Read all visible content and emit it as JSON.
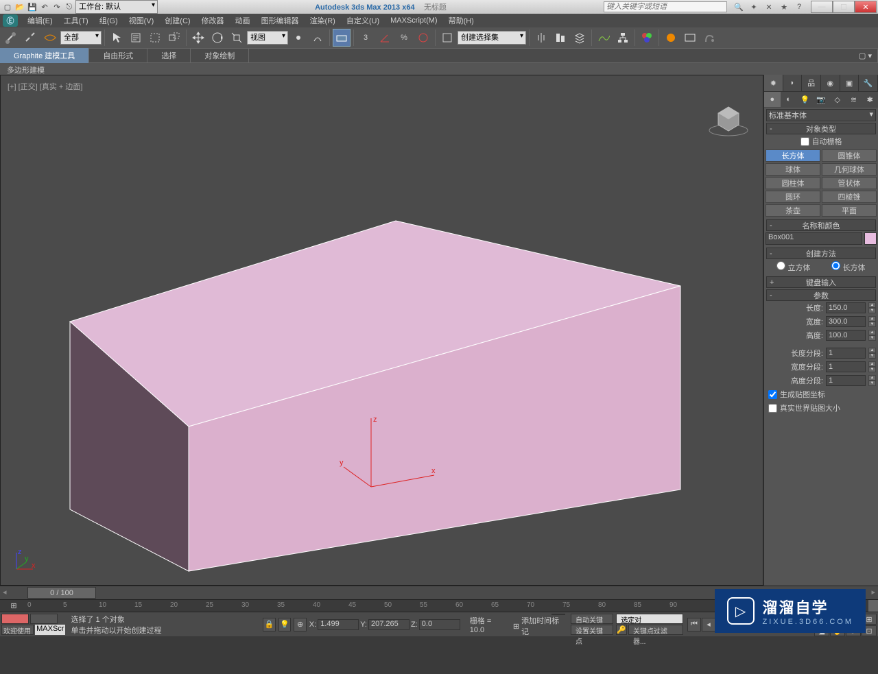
{
  "titlebar": {
    "workspace_label": "工作台: 默认",
    "app_title": "Autodesk 3ds Max  2013 x64",
    "doc_title": "无标题",
    "search_placeholder": "键入关键字或短语"
  },
  "menus": [
    "编辑(E)",
    "工具(T)",
    "组(G)",
    "视图(V)",
    "创建(C)",
    "修改器",
    "动画",
    "图形编辑器",
    "渲染(R)",
    "自定义(U)",
    "MAXScript(M)",
    "帮助(H)"
  ],
  "toolbar": {
    "filter_all": "全部",
    "view_mode": "视图",
    "selection_set": "创建选择集"
  },
  "ribbon": {
    "tabs": [
      "Graphite 建模工具",
      "自由形式",
      "选择",
      "对象绘制"
    ],
    "subpanel": "多边形建模"
  },
  "viewport": {
    "label": "[+] [正交] [真实 + 边面]",
    "axes": {
      "x": "x",
      "y": "y",
      "z": "z"
    }
  },
  "command_panel": {
    "category": "标准基本体",
    "object_type_header": "对象类型",
    "autogrid": "自动栅格",
    "primitives": [
      [
        "长方体",
        "圆锥体"
      ],
      [
        "球体",
        "几何球体"
      ],
      [
        "圆柱体",
        "管状体"
      ],
      [
        "圆环",
        "四棱锥"
      ],
      [
        "茶壶",
        "平面"
      ]
    ],
    "name_color_header": "名称和颜色",
    "object_name": "Box001",
    "creation_method_header": "创建方法",
    "creation_cube": "立方体",
    "creation_box": "长方体",
    "keyboard_entry_header": "键盘输入",
    "params_header": "参数",
    "length_label": "长度:",
    "length_value": "150.0",
    "width_label": "宽度:",
    "width_value": "300.0",
    "height_label": "高度:",
    "height_value": "100.0",
    "lsegs_label": "长度分段:",
    "lsegs_value": "1",
    "wsegs_label": "宽度分段:",
    "wsegs_value": "1",
    "hsegs_label": "高度分段:",
    "hsegs_value": "1",
    "gen_map": "生成贴图坐标",
    "real_world": "真实世界贴图大小"
  },
  "timeline": {
    "slider": "0 / 100",
    "ticks": [
      "0",
      "5",
      "10",
      "15",
      "20",
      "25",
      "30",
      "35",
      "40",
      "45",
      "50",
      "55",
      "60",
      "65",
      "70",
      "75",
      "80",
      "85",
      "90"
    ]
  },
  "status": {
    "welcome": "欢迎使用",
    "script": "MAXScr",
    "selected": "选择了 1 个对象",
    "prompt": "单击并拖动以开始创建过程",
    "x_label": "X:",
    "x_value": "1.499",
    "y_label": "Y:",
    "y_value": "207.265",
    "z_label": "Z:",
    "z_value": "0.0",
    "grid": "栅格 = 10.0",
    "add_time_tag": "添加时间标记",
    "auto_key": "自动关键点",
    "set_key": "设置关键点",
    "selected_obj": "选定对",
    "key_filters": "关键点过滤器..."
  },
  "watermark": {
    "main": "溜溜自学",
    "sub": "ZIXUE.3D66.COM"
  }
}
